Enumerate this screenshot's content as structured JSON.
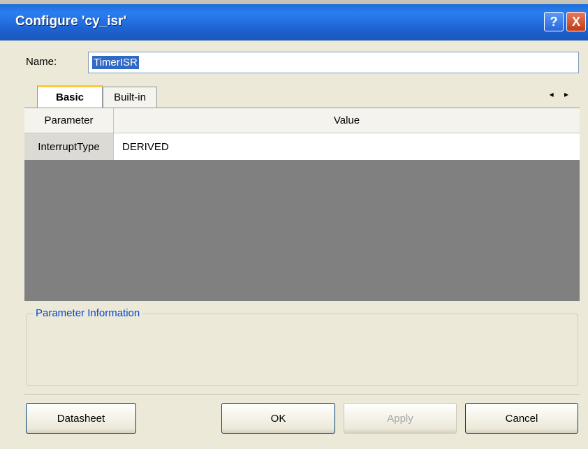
{
  "window": {
    "title": "Configure 'cy_isr'",
    "help_glyph": "?",
    "close_glyph": "X"
  },
  "name_field": {
    "label": "Name:",
    "value": "TimerISR"
  },
  "tabs": [
    {
      "label": "Basic",
      "active": true
    },
    {
      "label": "Built-in",
      "active": false
    }
  ],
  "tab_scroll": "◂ ▸",
  "grid": {
    "columns": [
      "Parameter",
      "Value"
    ],
    "rows": [
      {
        "parameter": "InterruptType",
        "value": "DERIVED"
      }
    ]
  },
  "parameter_info": {
    "legend": "Parameter Information"
  },
  "buttons": {
    "datasheet": "Datasheet",
    "ok": "OK",
    "apply": "Apply",
    "cancel": "Cancel"
  }
}
